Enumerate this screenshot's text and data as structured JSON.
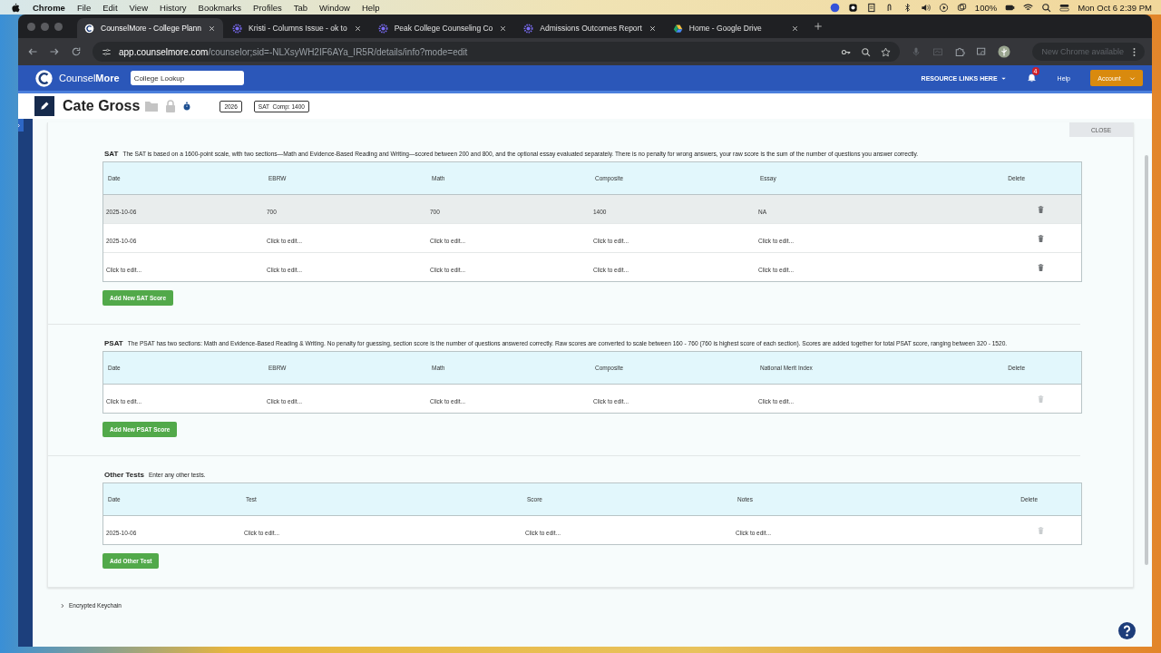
{
  "menu_bar": {
    "app": "Chrome",
    "items": [
      "File",
      "Edit",
      "View",
      "History",
      "Bookmarks",
      "Profiles",
      "Tab",
      "Window",
      "Help"
    ],
    "battery": "100%",
    "datetime": "Mon Oct 6  2:39 PM"
  },
  "browser": {
    "tabs": [
      {
        "title": "CounselMore - College Plann",
        "selected": true
      },
      {
        "title": "Kristi - Columns Issue - ok to",
        "selected": false
      },
      {
        "title": "Peak College Counseling Co",
        "selected": false
      },
      {
        "title": "Admissions Outcomes Report",
        "selected": false
      },
      {
        "title": "Home - Google Drive",
        "selected": false
      }
    ],
    "url": {
      "host": "app.counselmore.com",
      "path": "/counselor;sid=-NLXsyWH2IF6AYa_IR5R/details/info?mode=edit"
    },
    "update_chip": "New Chrome available"
  },
  "app_header": {
    "brand_regular": "Counsel",
    "brand_bold": "More",
    "search": {
      "placeholder": "College Lookup"
    },
    "resource_links": "RESOURCE LINKS HERE",
    "notification_count": "4",
    "help": "Help",
    "account": "Account"
  },
  "student": {
    "name": "Cate Gross",
    "year": "2026",
    "sat_badge": "SAT  Comp: 1400"
  },
  "close_button": "CLOSE",
  "sections": [
    {
      "kind": "sat",
      "title": "SAT",
      "description": "The SAT is based on a 1600-point scale, with two sections—Math and Evidence-Based Reading and Writing—scored between 200 and 800, and the optional essay evaluated separately. There is no penalty for wrong answers, your raw score is the sum of the number of questions you answer correctly.",
      "columns": [
        "Date",
        "EBRW",
        "Math",
        "Composite",
        "Essay",
        "Delete"
      ],
      "rows": [
        {
          "cells": [
            "2025-10-06",
            "700",
            "700",
            "1400",
            "NA"
          ],
          "hovered": true,
          "delete_disabled": false
        },
        {
          "cells": [
            "2025-10-06",
            "Click to edit...",
            "Click to edit...",
            "Click to edit...",
            "Click to edit..."
          ],
          "hovered": false,
          "delete_disabled": false
        },
        {
          "cells": [
            "Click to edit...",
            "Click to edit...",
            "Click to edit...",
            "Click to edit...",
            "Click to edit..."
          ],
          "hovered": false,
          "delete_disabled": false
        }
      ],
      "add_button": "Add New SAT Score"
    },
    {
      "kind": "psat",
      "title": "PSAT",
      "description": "The PSAT has two sections: Math and Evidence-Based Reading & Writing. No penalty for guessing, section score is the number of questions answered correctly. Raw scores are converted to scale between 160 - 760 (760 is highest score of each section). Scores are added together for total PSAT score, ranging between 320 - 1520.",
      "columns": [
        "Date",
        "EBRW",
        "Math",
        "Composite",
        "National Merit Index",
        "Delete"
      ],
      "rows": [
        {
          "cells": [
            "Click to edit...",
            "Click to edit...",
            "Click to edit...",
            "Click to edit...",
            "Click to edit..."
          ],
          "hovered": false,
          "delete_disabled": true
        }
      ],
      "add_button": "Add New PSAT Score"
    },
    {
      "kind": "other",
      "title": "Other Tests",
      "description": "Enter any other tests.",
      "columns": [
        "Date",
        "Test",
        "Score",
        "Notes",
        "Delete"
      ],
      "rows": [
        {
          "cells": [
            "2025-10-06",
            "Click to edit...",
            "Click to edit...",
            "Click to edit..."
          ],
          "hovered": false,
          "delete_disabled": true
        }
      ],
      "add_button": "Add Other Test"
    }
  ],
  "accordion": {
    "label": "Encrypted Keychain",
    "expanded": false
  }
}
